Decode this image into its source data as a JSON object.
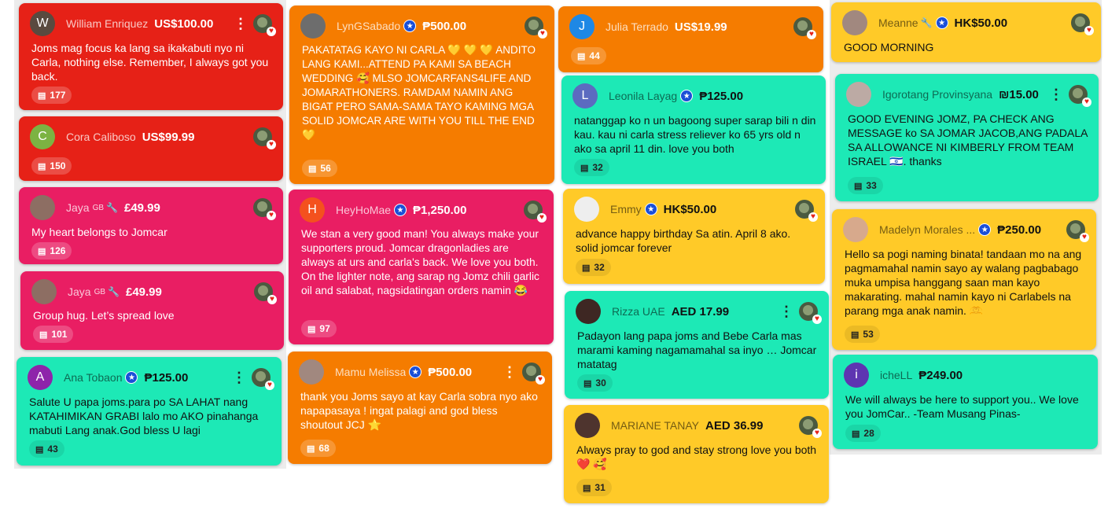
{
  "cards": [
    {
      "name": "William Enriquez",
      "amount": "US$100.00",
      "message": "Joms mag focus ka lang sa ikakabuti nyo ni Carla, nothing else. Remember, I always got you back.",
      "count": "177",
      "initial": "W"
    },
    {
      "name": "Cora Caliboso",
      "amount": "US$99.99",
      "message": "",
      "count": "150",
      "initial": "C"
    },
    {
      "name": "Jaya",
      "badge": "GB",
      "amount": "£49.99",
      "message": "My heart belongs to Jomcar",
      "count": "126"
    },
    {
      "name": "Jaya",
      "badge": "GB",
      "amount": "£49.99",
      "message": "Group hug. Let’s spread love",
      "count": "101"
    },
    {
      "name": "Ana Tobaon",
      "amount": "₱125.00",
      "message": "Salute U papa joms.para po SA LAHAT nang KATAHIMIKAN GRABI lalo mo AKO pinahanga mabuti Lang anak.God bless U lagi",
      "count": "43",
      "initial": "A"
    },
    {
      "name": "LynGSabado",
      "amount": "₱500.00",
      "message": "PAKATATAG KAYO NI CARLA 💛 💛 💛 ANDITO LANG KAMI...ATTEND PA KAMI SA BEACH WEDDING 🥰 MLSO JOMCARFANS4LIFE AND JOMARATHONERS. RAMDAM NAMIN ANG BIGAT PERO SAMA-SAMA TAYO KAMING MGA SOLID JOMCAR ARE WITH YOU TILL THE END 💛",
      "count": "56"
    },
    {
      "name": "HeyHoMae",
      "amount": "₱1,250.00",
      "message": "We stan a very good man! You always make your supporters proud. Jomcar dragonladies are always at urs and carla's back. We love you both. On the lighter note, ang sarap ng Jomz chili garlic oil and salabat, nagsidatingan orders namin 😂",
      "count": "97",
      "initial": "H"
    },
    {
      "name": "Mamu Melissa",
      "amount": "₱500.00",
      "message": "thank you Joms sayo at kay Carla sobra nyo ako napapasaya ! ingat palagi and god bless shoutout JCJ ⭐",
      "count": "68"
    },
    {
      "name": "Julia Terrado",
      "amount": "US$19.99",
      "message": "",
      "count": "44",
      "initial": "J"
    },
    {
      "name": "Leonila Layag",
      "amount": "₱125.00",
      "message": "natanggap ko n un bagoong super sarap bili n din kau. kau ni carla stress reliever ko 65 yrs old n ako sa april 11 din. love you both",
      "count": "32",
      "initial": "L"
    },
    {
      "name": "Emmy",
      "amount": "HK$50.00",
      "message": "advance happy birthday Sa atin. April 8 ako. solid jomcar forever",
      "count": "32"
    },
    {
      "name": "Rizza UAE",
      "amount": "AED 17.99",
      "message": "Padayon lang papa joms and Bebe Carla mas marami kaming nagamamahal sa inyo … Jomcar matatag",
      "count": "30"
    },
    {
      "name": "MARIANE TANAY",
      "amount": "AED 36.99",
      "message": "Always pray to god and stay strong love you both ❤️ 🥰",
      "count": "31"
    },
    {
      "name": "Meanne",
      "amount": "HK$50.00",
      "message": "GOOD MORNING",
      "count": ""
    },
    {
      "name": "Igorotang Provinsyana",
      "amount": "₪15.00",
      "message": "GOOD EVENING JOMZ, PA CHECK ANG MESSAGE ko SA JOMAR JACOB,ANG PADALA SA ALLOWANCE NI KIMBERLY FROM TEAM ISRAEL 🇮🇱. thanks",
      "count": "33"
    },
    {
      "name": "Madelyn Morales ...",
      "amount": "₱250.00",
      "message": "Hello sa pogi naming binata! tandaan mo na ang pagmamahal namin sayo ay walang pagbabago muka umpisa hanggang saan man kayo makarating. mahal namin kayo ni Carlabels na parang mga anak namin. 🫶",
      "count": "53"
    },
    {
      "name": "icheLL",
      "amount": "₱249.00",
      "message": "We will always be here to support you.. We love you JomCar.. -Team Musang Pinas-",
      "count": "28",
      "initial": "i"
    }
  ],
  "colors": {
    "red": "#e62117",
    "pink": "#e91e63",
    "orange": "#f57c00",
    "yellow": "#ffca28",
    "teal": "#1de9b6"
  },
  "icons": {
    "more": "more-vert-icon",
    "comment": "comment-icon",
    "verified": "verified-badge-icon",
    "wrench": "wrench-icon",
    "heart": "heart-icon"
  }
}
